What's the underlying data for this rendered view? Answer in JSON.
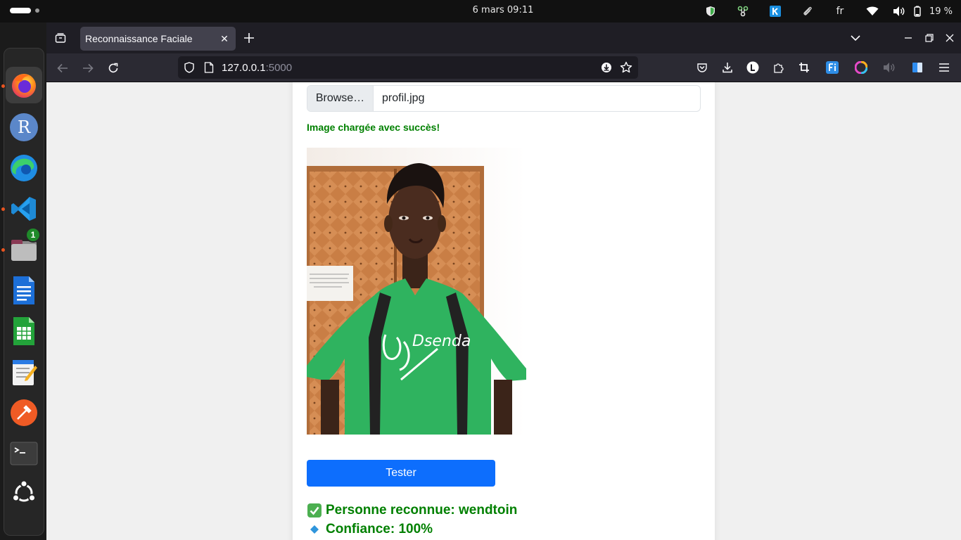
{
  "topbar": {
    "clock": "6 mars  09:11",
    "language": "fr",
    "battery_percent": "19 %"
  },
  "browser": {
    "tab_title": "Reconnaissance Faciale",
    "url_host": "127.0.0.1",
    "url_port": ":5000"
  },
  "dock": {
    "files_badge": "1",
    "r_label": "R"
  },
  "page": {
    "browse_label": "Browse…",
    "file_name": "profil.jpg",
    "upload_status": "Image chargée avec succès!",
    "photo_shirt_text": "Dsenda",
    "test_button": "Tester",
    "result_person": "Personne reconnue: wendtoin",
    "result_confidence": "Confiance: 100%"
  },
  "colors": {
    "success_green": "#008000",
    "primary_blue": "#0d6efd",
    "firefox_toolbar": "#2b2a33",
    "shirt_green": "#2fb35f"
  }
}
